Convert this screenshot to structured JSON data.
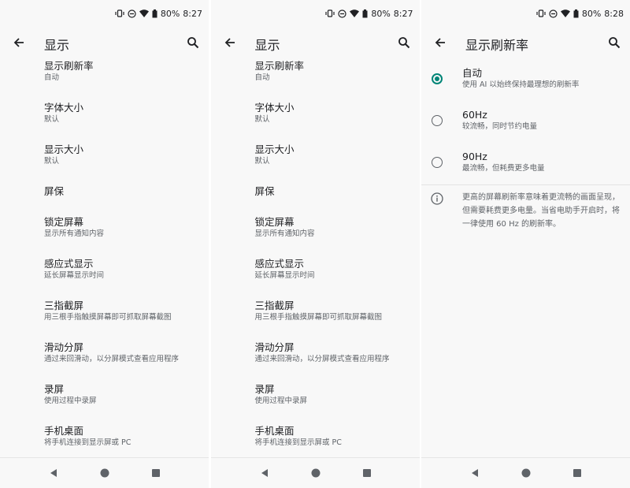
{
  "status": {
    "screen1": {
      "battery": "80%",
      "time": "8:27"
    },
    "screen2": {
      "battery": "80%",
      "time": "8:27"
    },
    "screen3": {
      "battery": "80%",
      "time": "8:28"
    }
  },
  "display_screen": {
    "title": "显示",
    "items": [
      {
        "title": "显示刷新率",
        "subtitle": "自动"
      },
      {
        "title": "字体大小",
        "subtitle": "默认"
      },
      {
        "title": "显示大小",
        "subtitle": "默认"
      },
      {
        "title": "屏保",
        "subtitle": ""
      },
      {
        "title": "锁定屏幕",
        "subtitle": "显示所有通知内容"
      },
      {
        "title": "感应式显示",
        "subtitle": "延长屏幕显示时间"
      },
      {
        "title": "三指截屏",
        "subtitle": "用三根手指触摸屏幕即可抓取屏幕截图"
      },
      {
        "title": "滑动分屏",
        "subtitle": "通过来回滑动，以分屏模式查看应用程序"
      },
      {
        "title": "录屏",
        "subtitle": "使用过程中录屏"
      },
      {
        "title": "手机桌面",
        "subtitle": "将手机连接到显示屏或 PC"
      }
    ]
  },
  "refresh_screen": {
    "title": "显示刷新率",
    "options": [
      {
        "title": "自动",
        "subtitle": "使用 AI 以始终保持最理想的刷新率",
        "selected": true
      },
      {
        "title": "60Hz",
        "subtitle": "较流畅，同时节约电量",
        "selected": false
      },
      {
        "title": "90Hz",
        "subtitle": "最流畅，但耗费更多电量",
        "selected": false
      }
    ],
    "info": "更高的屏幕刷新率意味着更流畅的画面呈现，但需要耗费更多电量。当省电助手开启时，将一律使用 60 Hz 的刷新率。"
  },
  "icons": {
    "back": "arrow-back-icon",
    "search": "search-icon",
    "nav_back": "nav-back-icon",
    "nav_home": "nav-home-icon",
    "nav_recents": "nav-recents-icon",
    "info": "info-icon"
  },
  "colors": {
    "accent": "#008577",
    "background": "#f8f8f8"
  }
}
